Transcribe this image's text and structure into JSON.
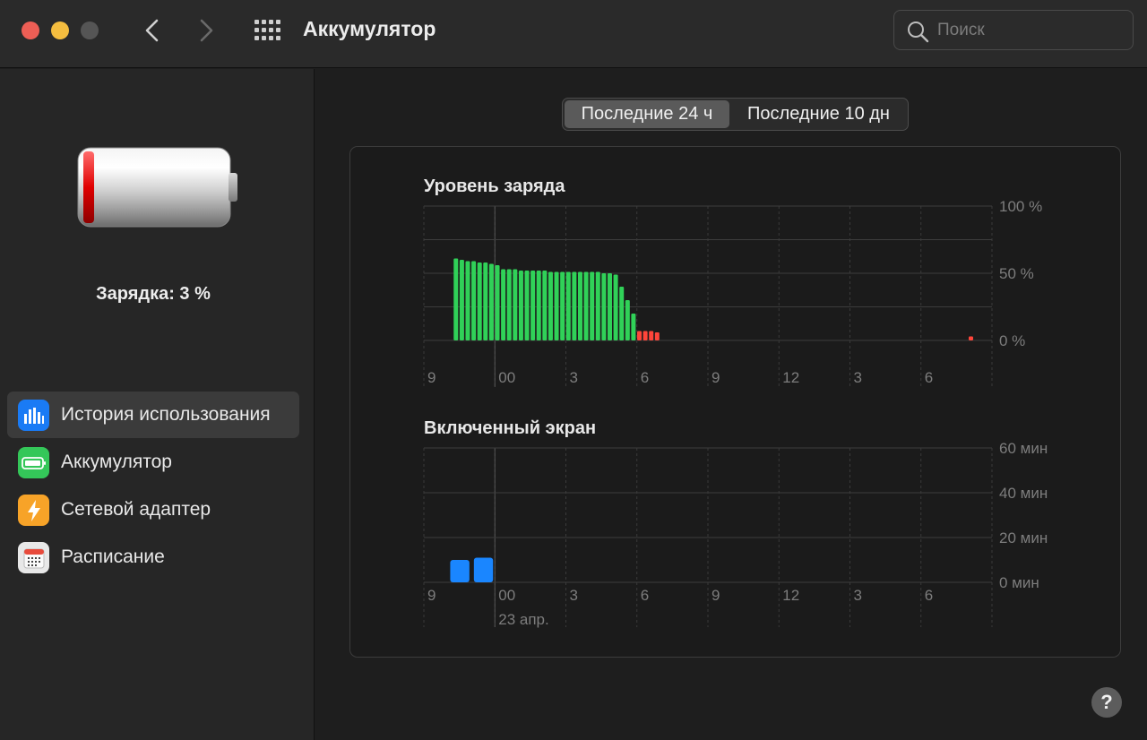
{
  "window": {
    "title": "Аккумулятор"
  },
  "search": {
    "placeholder": "Поиск"
  },
  "sidebar": {
    "charge_label": "Зарядка: 3 %",
    "items": [
      {
        "label": "История использования",
        "icon": "bar-chart-icon",
        "color": "#1a7bf5",
        "active": true
      },
      {
        "label": "Аккумулятор",
        "icon": "battery-icon",
        "color": "#34c759",
        "active": false
      },
      {
        "label": "Сетевой адаптер",
        "icon": "lightning-icon",
        "color": "#f7a328",
        "active": false
      },
      {
        "label": "Расписание",
        "icon": "calendar-icon",
        "color": "#e8e8e8",
        "active": false
      }
    ]
  },
  "range_tabs": [
    {
      "label": "Последние 24 ч",
      "selected": true
    },
    {
      "label": "Последние 10 дн",
      "selected": false
    }
  ],
  "help_label": "?",
  "chart_data": [
    {
      "type": "bar",
      "title": "Уровень заряда",
      "x_tick_labels": [
        "9",
        "00",
        "3",
        "6",
        "9",
        "12",
        "3",
        "6"
      ],
      "y_tick_labels": [
        "100 %",
        "50 %",
        "0 %"
      ],
      "ylim": [
        0,
        100
      ],
      "grid": true,
      "legend": "none",
      "colors": {
        "normal": "#30d158",
        "low": "#ff453a"
      },
      "series": [
        {
          "values": [
            61,
            60,
            59,
            59,
            58,
            58,
            57,
            56,
            53,
            53,
            53,
            52,
            52,
            52,
            52,
            52,
            51,
            51,
            51,
            51,
            51,
            51,
            51,
            51,
            51,
            50,
            50,
            49,
            40,
            30,
            20,
            7,
            7,
            7,
            6,
            6,
            6,
            6,
            6,
            6,
            5,
            5,
            5,
            5,
            4,
            4,
            4,
            4,
            4,
            4,
            4,
            4,
            4,
            4,
            4,
            4,
            4,
            4,
            4,
            4,
            4,
            3,
            3,
            3,
            3,
            3,
            3,
            3,
            3,
            3,
            3,
            3,
            3,
            3,
            3,
            3,
            3,
            3,
            3,
            3,
            3,
            3,
            3,
            3,
            3,
            3,
            3,
            3,
            3,
            3,
            3,
            3,
            3,
            3,
            3,
            3,
            3,
            3,
            3,
            3
          ],
          "visible_from": 0,
          "low_threshold": 10
        }
      ]
    },
    {
      "type": "bar",
      "title": "Включенный экран",
      "x_tick_labels": [
        "9",
        "00",
        "3",
        "6",
        "9",
        "12",
        "3",
        "6"
      ],
      "x_sub_label": "23 апр.",
      "y_tick_labels": [
        "60 мин",
        "40 мин",
        "20 мин",
        "0 мин"
      ],
      "ylim": [
        0,
        60
      ],
      "grid": true,
      "legend": "none",
      "colors": {
        "bar": "#1a86ff"
      },
      "values_min_per_hour": [
        0,
        10,
        11,
        0,
        0,
        0,
        0,
        0,
        0,
        0,
        0,
        0,
        0,
        0,
        0,
        0,
        0,
        0,
        0,
        0,
        0,
        0,
        0,
        0
      ]
    }
  ]
}
